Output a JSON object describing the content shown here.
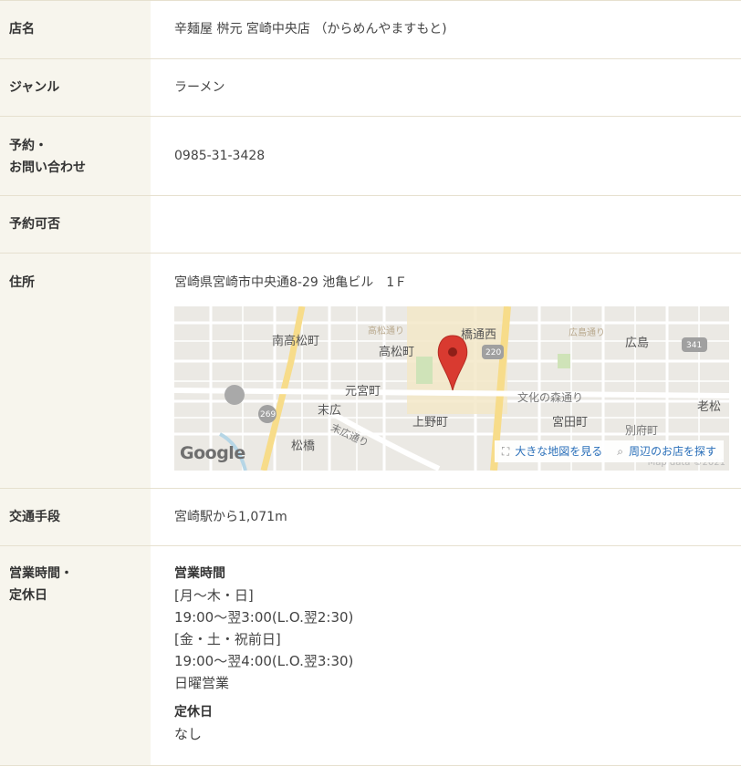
{
  "rows": {
    "name": {
      "label": "店名",
      "value": "辛麺屋 桝元 宮崎中央店 （からめんやますもと)"
    },
    "genre": {
      "label": "ジャンル",
      "value": "ラーメン"
    },
    "reservation": {
      "label_line1": "予約・",
      "label_line2": "お問い合わせ",
      "value": "0985-31-3428"
    },
    "reservable": {
      "label": "予約可否",
      "value": ""
    },
    "address": {
      "label": "住所",
      "value": "宮崎県宮崎市中央通8-29 池亀ビル　1Ｆ"
    },
    "transport": {
      "label": "交通手段",
      "value": "宮崎駅から1,071m"
    },
    "hours": {
      "label_line1": "営業時間・",
      "label_line2": "定休日",
      "hours_title": "営業時間",
      "hours_lines": [
        "[月～木・日]",
        "19:00～翌3:00(L.O.翌2:30)",
        "[金・土・祝前日]",
        "19:00～翌4:00(L.O.翌3:30)",
        "日曜営業"
      ],
      "closed_title": "定休日",
      "closed_value": "なし"
    }
  },
  "map": {
    "labels": {
      "minami_takamatsu": "南高松町",
      "takamatsu": "高松町",
      "hashidori_nishi": "橋通西",
      "hiroshima": "広島",
      "motomiya": "元宮町",
      "suehiro": "末広",
      "kamino": "上野町",
      "bunka": "文化の森通り",
      "miyata": "宮田町",
      "oimatsu": "老松",
      "matsuhashi": "松橋",
      "suehiro_dori": "末広通り",
      "betsufu": "別府町",
      "takamatsu_dori": "高松通り",
      "hiroshima_dori": "広島通り",
      "route_220": "220",
      "route_341": "341",
      "route_269": "269"
    },
    "google_logo": "Google",
    "bigmap_link": "大きな地図を見る",
    "nearby_link": "周辺のお店を探す",
    "map_data": "Map data ©2021",
    "pin_color": "#d93a30",
    "icons": {
      "bigmap": "expand-icon",
      "nearby": "search-icon"
    }
  }
}
